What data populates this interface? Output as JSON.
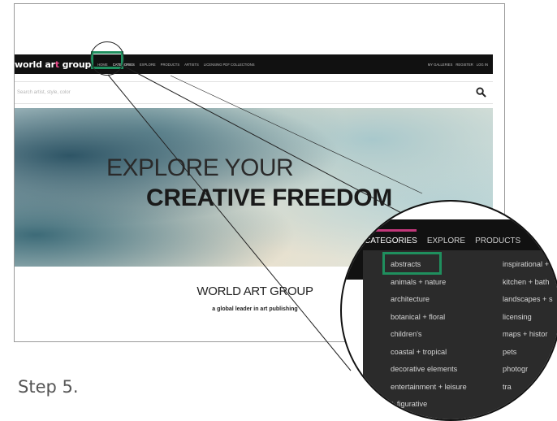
{
  "site": {
    "logo_text_pre": "world ar",
    "logo_text_accent": "t",
    "logo_text_post": " group",
    "nav": [
      "HOME",
      "CATEGORIES",
      "EXPLORE",
      "PRODUCTS",
      "ARTISTS",
      "LICENSING PDF COLLECTIONS"
    ],
    "account": [
      "MY GALLERIES",
      "REGISTER",
      "LOG IN"
    ],
    "search_placeholder": "Search artist, style, color",
    "hero_line1": "EXPLORE YOUR",
    "hero_line2": "CREATIVE FREEDOM",
    "brand_heading": "WORLD ART GROUP",
    "brand_tagline": "a global leader in art publishing"
  },
  "magnifier": {
    "nav": [
      "CATEGORIES",
      "EXPLORE",
      "PRODUCTS"
    ],
    "col1": [
      "abstracts",
      "animals + nature",
      "architecture",
      "botanical + floral",
      "children's",
      "coastal + tropical",
      "decorative elements",
      "entertainment + leisure",
      "+ figurative"
    ],
    "col2": [
      "inspirational +",
      "kitchen + bath",
      "landscapes + s",
      "licensing",
      "maps + histor",
      "pets",
      "photogr",
      "tra"
    ]
  },
  "step_label": "Step 5.",
  "colors": {
    "highlight": "#1f8f5e",
    "accent_pink": "#c2377a",
    "nav_bg": "#111111"
  }
}
